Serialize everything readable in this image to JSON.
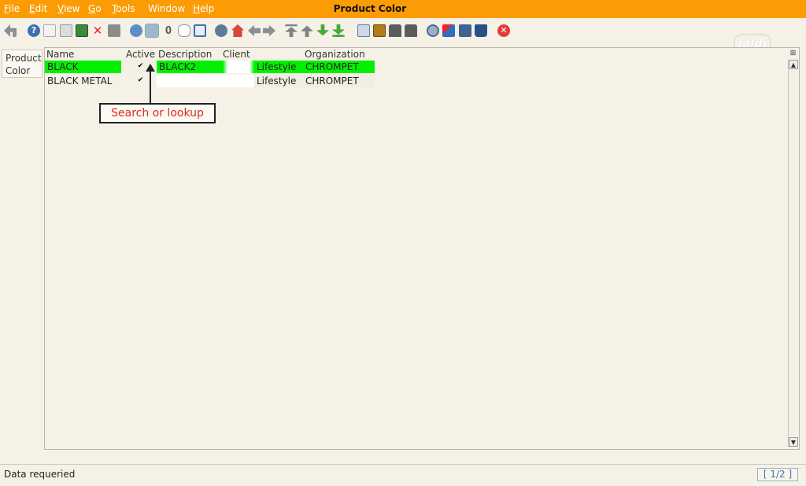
{
  "menubar": {
    "items": [
      {
        "label": "File",
        "accel": "F"
      },
      {
        "label": "Edit",
        "accel": "E"
      },
      {
        "label": "View",
        "accel": "V"
      },
      {
        "label": "Go",
        "accel": "G"
      },
      {
        "label": "Tools",
        "accel": "T"
      },
      {
        "label": "Window",
        "accel": ""
      },
      {
        "label": "Help",
        "accel": "H"
      }
    ],
    "title": "Product Color",
    "bg_color": "#fb9c04"
  },
  "toolbar": {
    "icons": [
      "undo-icon",
      "help-icon",
      "new-record-icon",
      "copy-record-icon",
      "save-icon",
      "delete-icon",
      "save-disabled-icon",
      "refresh-icon",
      "search-lookup-icon",
      "attachment-icon",
      "chat-icon",
      "grid-toggle-icon",
      "history-icon",
      "home-icon",
      "previous-icon",
      "next-icon",
      "first-record-icon",
      "previous-record-icon",
      "next-record-icon",
      "last-record-icon",
      "report-icon",
      "archive-icon",
      "print-preview-icon",
      "print-icon",
      "zoom-across-icon",
      "workflow-icon",
      "request-icon",
      "product-info-icon",
      "exit-icon"
    ]
  },
  "logo": {
    "text": "jaldi"
  },
  "sidetab": {
    "label_line1": "Product",
    "label_line2": "Color"
  },
  "grid": {
    "columns": [
      "Name",
      "Active",
      "Description",
      "Client",
      "Organization"
    ],
    "rows": [
      {
        "name": "BLACK",
        "active": true,
        "description": "BLACK2",
        "client": "Lifestyle",
        "organization": "CHROMPET",
        "selected": true
      },
      {
        "name": "BLACK METAL",
        "active": true,
        "description": "",
        "client": "Lifestyle",
        "organization": "CHROMPET",
        "selected": false
      }
    ],
    "highlight_color": "#00f000"
  },
  "callout": {
    "text": "Search or lookup",
    "text_color": "#e0281a"
  },
  "status": {
    "message": "Data requeried",
    "record_count": "[ 1/2 ]"
  }
}
